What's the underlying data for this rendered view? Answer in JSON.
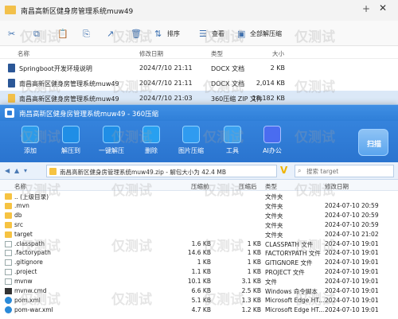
{
  "explorer": {
    "title": "南昌高新区健身房管理系统muw49",
    "toolbar": {
      "sort_label": "排序",
      "view_label": "查看",
      "select_all_label": "全部解压缩"
    },
    "columns": [
      "名称",
      "修改日期",
      "类型",
      "大小"
    ],
    "files": [
      {
        "name": "Springboot开发环境说明",
        "date": "2024/7/10 21:11",
        "type": "DOCX 文档",
        "size": "2 KB"
      },
      {
        "name": "南昌高新区健身房管理系统muw49",
        "date": "2024/7/10 21:11",
        "type": "DOCX 文档",
        "size": "2,014 KB"
      },
      {
        "name": "南昌高新区健身房管理系统muw49",
        "date": "2024/7/10 21:03",
        "type": "360压缩 ZIP 文件",
        "size": "18,182 KB"
      }
    ]
  },
  "zip": {
    "title": "南昌高新区健身房管理系统muw49 - 360压缩",
    "tools": [
      {
        "label": "添加",
        "color": "#2b9bea"
      },
      {
        "label": "解压到",
        "color": "#1f8ee6"
      },
      {
        "label": "一键解压",
        "color": "#1f8ee6"
      },
      {
        "label": "删除",
        "color": "#27a0f0"
      },
      {
        "label": "图片压缩",
        "color": "#2f9bf0"
      },
      {
        "label": "工具",
        "color": "#3aa1f0"
      },
      {
        "label": "AI办公",
        "color": "#4a6cf0"
      }
    ],
    "scan_label": "扫描",
    "address": "南昌高新区健身房管理系统muw49.zip - 解包大小为 42.4 MB",
    "search_placeholder": "搜索 target",
    "columns": {
      "name": "名称",
      "size": "压缩前",
      "compressed": "压缩后",
      "type": "类型",
      "date": "修改日期"
    },
    "rows": [
      {
        "name": ".. (上级目录)",
        "size": "",
        "compressed": "",
        "type": "文件夹",
        "date": "",
        "icon": "folder"
      },
      {
        "name": ".mvn",
        "size": "",
        "compressed": "",
        "type": "文件夹",
        "date": "2024-07-10 20:59",
        "icon": "folder"
      },
      {
        "name": "db",
        "size": "",
        "compressed": "",
        "type": "文件夹",
        "date": "2024-07-10 20:59",
        "icon": "folder"
      },
      {
        "name": "src",
        "size": "",
        "compressed": "",
        "type": "文件夹",
        "date": "2024-07-10 20:59",
        "icon": "folder"
      },
      {
        "name": "target",
        "size": "",
        "compressed": "",
        "type": "文件夹",
        "date": "2024-07-10 21:02",
        "icon": "folder"
      },
      {
        "name": ".classpath",
        "size": "1.6 KB",
        "compressed": "1 KB",
        "type": "CLASSPATH 文件",
        "date": "2024-07-10 19:01",
        "icon": "file"
      },
      {
        "name": ".factorypath",
        "size": "14.6 KB",
        "compressed": "1 KB",
        "type": "FACTORYPATH 文件",
        "date": "2024-07-10 19:01",
        "icon": "file"
      },
      {
        "name": ".gitignore",
        "size": "1 KB",
        "compressed": "1 KB",
        "type": "GITIGNORE 文件",
        "date": "2024-07-10 19:01",
        "icon": "file"
      },
      {
        "name": ".project",
        "size": "1.1 KB",
        "compressed": "1 KB",
        "type": "PROJECT 文件",
        "date": "2024-07-10 19:01",
        "icon": "file"
      },
      {
        "name": "mvnw",
        "size": "10.1 KB",
        "compressed": "3.1 KB",
        "type": "文件",
        "date": "2024-07-10 19:01",
        "icon": "file"
      },
      {
        "name": "mvnw.cmd",
        "size": "6.6 KB",
        "compressed": "2.5 KB",
        "type": "Windows 命令脚本",
        "date": "2024-07-10 19:01",
        "icon": "cmd"
      },
      {
        "name": "pom.xml",
        "size": "5.1 KB",
        "compressed": "1.3 KB",
        "type": "Microsoft Edge HT...",
        "date": "2024-07-10 19:01",
        "icon": "edge"
      },
      {
        "name": "pom-war.xml",
        "size": "4.7 KB",
        "compressed": "1.2 KB",
        "type": "Microsoft Edge HT...",
        "date": "2024-07-10 19:01",
        "icon": "edge"
      }
    ]
  },
  "watermark": "仅测试"
}
